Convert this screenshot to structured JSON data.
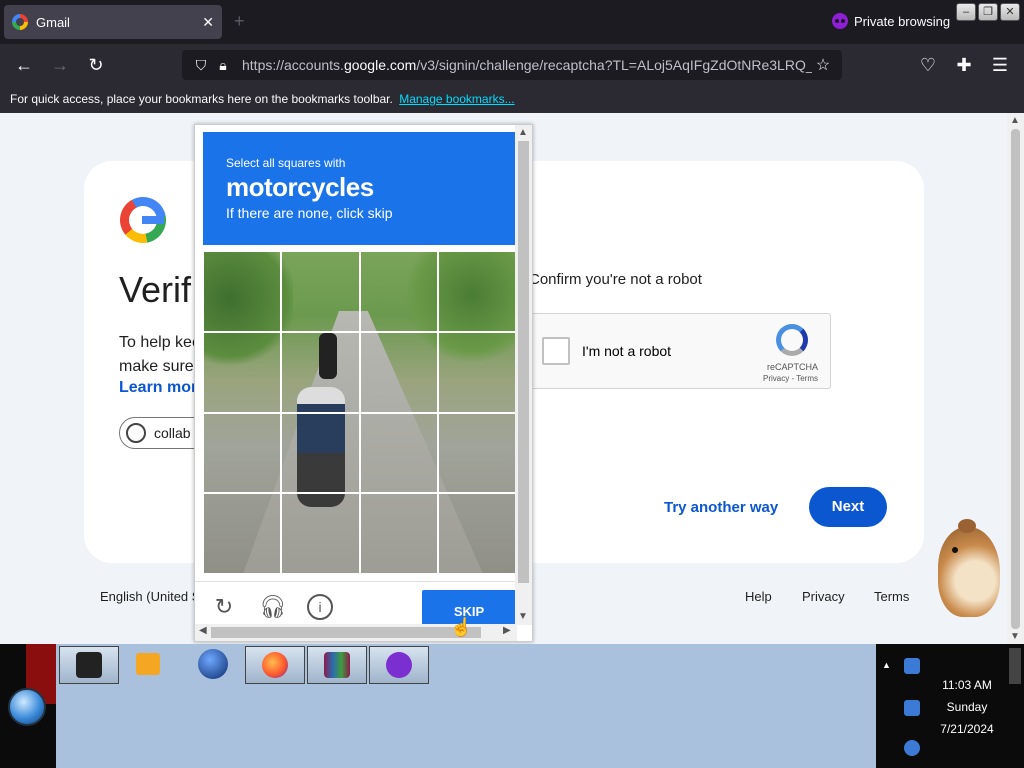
{
  "browser": {
    "tab_title": "Gmail",
    "tab_close": "✕",
    "new_tab": "+",
    "private_label": "Private browsing",
    "url_domain_prefix": "https://accounts.",
    "url_domain": "google.com",
    "url_path": "/v3/signin/challenge/recaptcha?TL=ALoj5AqIFgZdOtNRe3LRQ_&",
    "bookmarks_text": "For quick access, place your bookmarks here on the bookmarks toolbar.",
    "bookmarks_link": "Manage bookmarks..."
  },
  "signin": {
    "heading": "Verif",
    "help_line1": "To help kee",
    "help_line2": "make sure",
    "learn_more": "Learn mor",
    "account": "collab",
    "confirm_text": "Confirm you're not a robot",
    "robot_label": "I'm not a robot",
    "recaptcha_brand": "reCAPTCHA",
    "recaptcha_terms": "Privacy - Terms",
    "try_another": "Try another way",
    "next": "Next"
  },
  "footer": {
    "language": "English (United St",
    "help": "Help",
    "privacy": "Privacy",
    "terms": "Terms"
  },
  "challenge": {
    "instruction": "Select all squares with",
    "object": "motorcycles",
    "hint": "If there are none, click skip",
    "skip": "SKIP",
    "grid_rows": 4,
    "grid_cols": 4
  },
  "taskbar": {
    "time": "11:03 AM",
    "day": "Sunday",
    "date": "7/21/2024"
  }
}
